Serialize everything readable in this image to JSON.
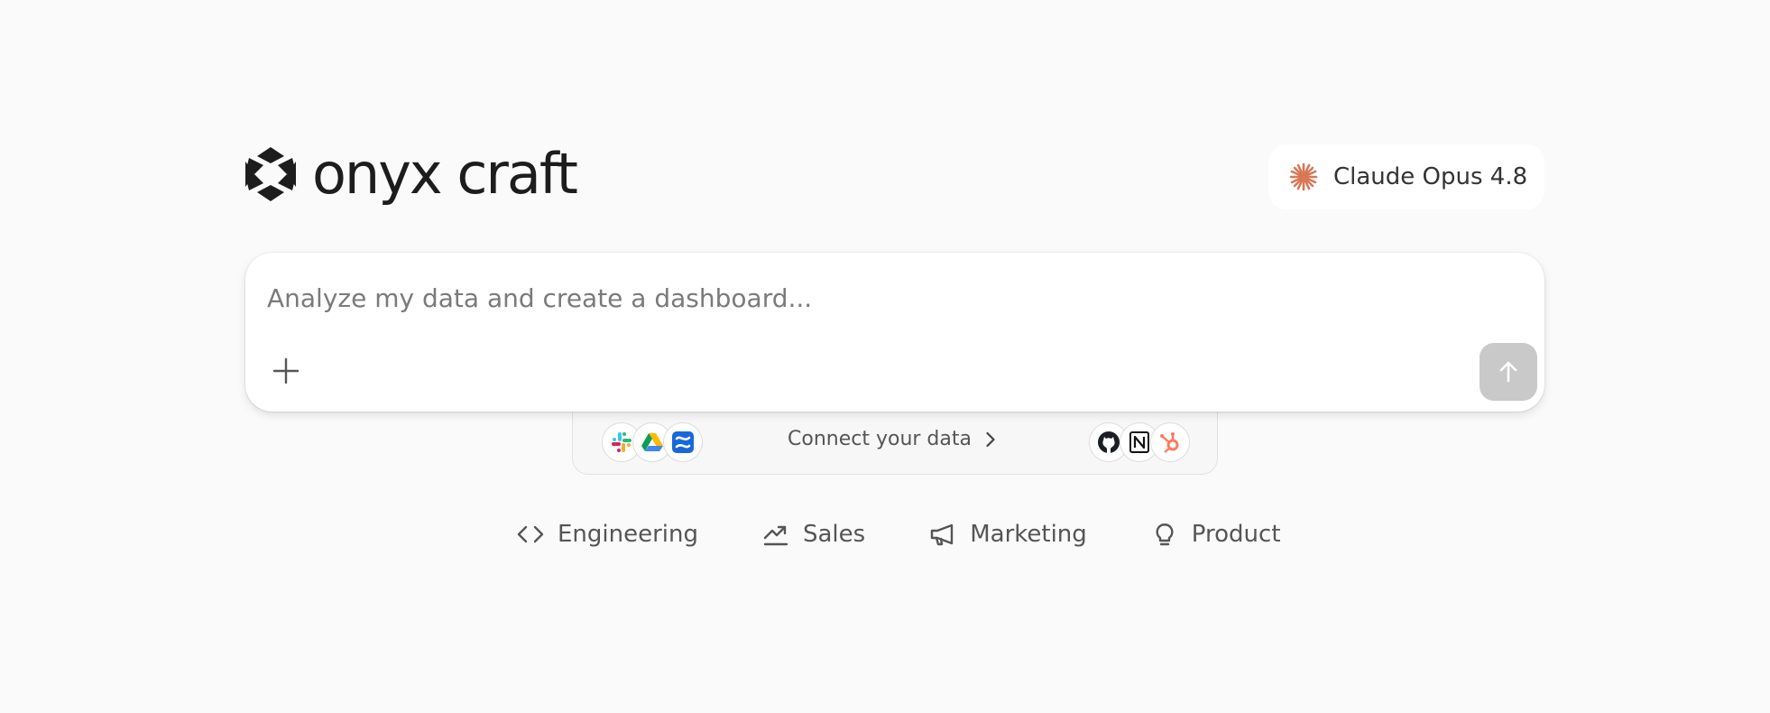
{
  "brand": {
    "name": "onyx craft",
    "logo_icon": "onyx-logo-icon"
  },
  "model_selector": {
    "label": "Claude Opus 4.8",
    "icon": "claude-sparkle-icon",
    "accent_color": "#D97757"
  },
  "composer": {
    "placeholder": "Analyze my data and create a dashboard...",
    "value": "",
    "attach_icon": "plus-icon",
    "send_icon": "arrow-up-icon",
    "send_button_color": "#C9C9C9"
  },
  "connect": {
    "label": "Connect your data",
    "chevron_icon": "chevron-right-icon",
    "left_apps": [
      "slack-icon",
      "google-drive-icon",
      "confluence-icon"
    ],
    "right_apps": [
      "github-icon",
      "notion-icon",
      "hubspot-icon"
    ]
  },
  "categories": [
    {
      "label": "Engineering",
      "icon": "code-icon"
    },
    {
      "label": "Sales",
      "icon": "trending-up-icon"
    },
    {
      "label": "Marketing",
      "icon": "megaphone-icon"
    },
    {
      "label": "Product",
      "icon": "lightbulb-icon"
    }
  ]
}
